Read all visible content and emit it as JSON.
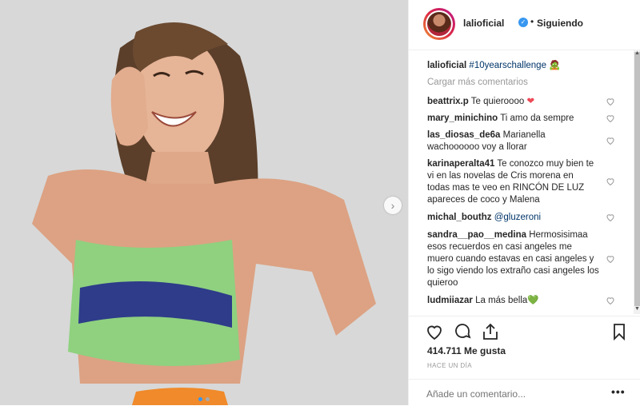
{
  "post": {
    "username": "lalioficial",
    "follow_status": "Siguiendo",
    "dot": "•",
    "caption_user": "lalioficial",
    "caption_hashtag": "#10yearschallenge",
    "load_more": "Cargar más comentarios",
    "likes": "414.711 Me gusta",
    "time_ago": "HACE UN DÍA",
    "add_comment_placeholder": "Añade un comentario...",
    "more_options": "•••",
    "next_arrow": "›"
  },
  "comments": [
    {
      "user": "beattrix.p",
      "text": " Te quieroooo ",
      "emoji": "❤"
    },
    {
      "user": "mary_minichino",
      "text": " Ti amo da sempre"
    },
    {
      "user": "las_diosas_de6a",
      "text": " Marianella wachoooooo voy a llorar"
    },
    {
      "user": "karinaperalta41",
      "text": " Te conozco muy bien te vi en las novelas de Cris morena en todas mas te veo en RINCÓN DE LUZ apareces de coco y Malena"
    },
    {
      "user": "michal_bouthz",
      "mention": "@gluzeroni"
    },
    {
      "user": "sandra__pao__medina",
      "text": " Hermosisimaa esos recuerdos en casi angeles me muero cuando estavas en casi angeles y lo sigo viendo los extraño casi angeles los quieroo"
    },
    {
      "user": "ludmiiazar",
      "text": " La más bella",
      "emoji": "💚"
    }
  ],
  "colors": {
    "accent": "#3897f0",
    "heart_red": "#ed4956",
    "heart_green": "#2ecc40",
    "link": "#003569"
  },
  "icons": [
    "heart-icon",
    "comment-icon",
    "share-icon",
    "bookmark-icon",
    "verified-icon",
    "chevron-right-icon"
  ]
}
